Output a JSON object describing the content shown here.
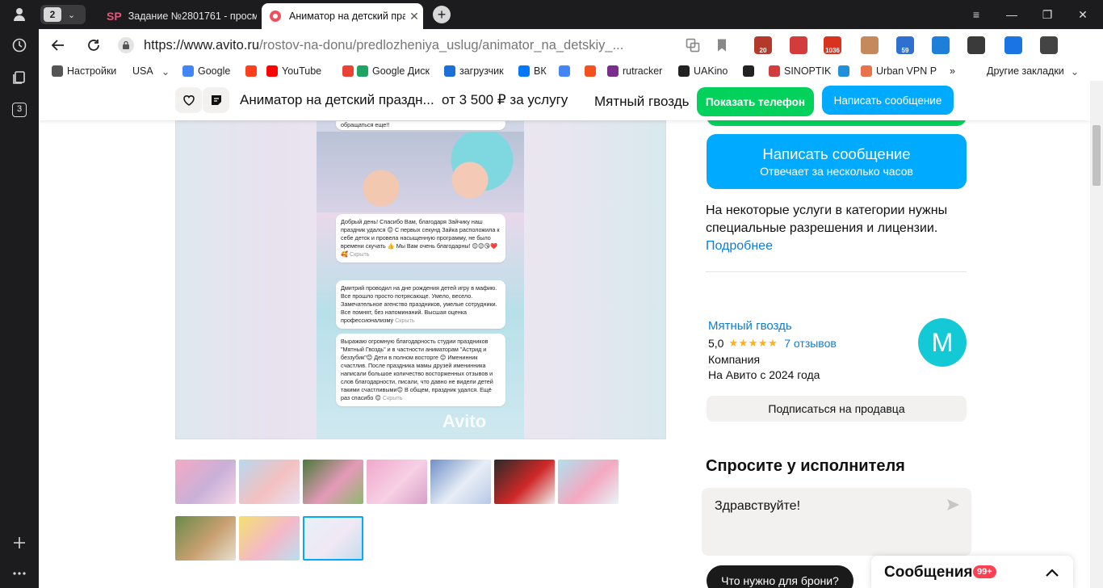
{
  "browser": {
    "tab_group_count": "2",
    "tabs": [
      {
        "favicon": "SP",
        "title": "Задание №2801761 - просм",
        "active": false
      },
      {
        "favicon": "avito-dot",
        "title": "Аниматор на детский празд",
        "active": true
      }
    ],
    "url_host": "https://www.avito.ru",
    "url_path": "/rostov-na-donu/predlozheniya_uslug/animator_na_detskiy_...",
    "rail_badge": "3",
    "extensions": [
      {
        "label": "20",
        "color": "#b33a2b"
      },
      {
        "label": "",
        "color": "#d43c3c"
      },
      {
        "label": "1036",
        "color": "#d9321f"
      },
      {
        "label": "",
        "color": "#c58a5c"
      },
      {
        "label": "59",
        "color": "#2f6fd0"
      },
      {
        "label": "",
        "color": "#1e7fd8"
      },
      {
        "label": "",
        "color": "#3a3a3a"
      },
      {
        "label": "",
        "color": "#1b74e4"
      },
      {
        "label": "",
        "color": "#444444"
      }
    ]
  },
  "bookmarks": [
    {
      "label": "Настройки",
      "icon": "gear-icon",
      "color": "#555555"
    },
    {
      "label": "USA",
      "icon": "",
      "color": ""
    },
    {
      "label": "Google",
      "icon": "google-icon",
      "color": "#4285f4"
    },
    {
      "label": "",
      "icon": "yandex-icon",
      "color": "#fc3f1d"
    },
    {
      "label": "YouTube",
      "icon": "youtube-icon",
      "color": "#ff0000"
    },
    {
      "label": "",
      "icon": "gmail-icon",
      "color": "#ea4335"
    },
    {
      "label": "Google Диск",
      "icon": "drive-icon",
      "color": "#1fa463"
    },
    {
      "label": "загрузчик",
      "icon": "loader-icon",
      "color": "#1b6fd6"
    },
    {
      "label": "ВК",
      "icon": "vk-icon",
      "color": "#0077ff"
    },
    {
      "label": "",
      "icon": "translate-icon",
      "color": "#4285f4"
    },
    {
      "label": "",
      "icon": "f-icon",
      "color": "#f4511e"
    },
    {
      "label": "rutracker",
      "icon": "rutracker-icon",
      "color": "#7b2d8b"
    },
    {
      "label": "UAKino",
      "icon": "uakino-icon",
      "color": "#222222"
    },
    {
      "label": "",
      "icon": "chess-icon",
      "color": "#222222"
    },
    {
      "label": "SINOPTIK",
      "icon": "sinoptik-icon",
      "color": "#d33c3c"
    },
    {
      "label": "",
      "icon": "p-icon",
      "color": "#1e8fd8"
    },
    {
      "label": "Urban VPN P",
      "icon": "urban-icon",
      "color": "#e6734a"
    }
  ],
  "bookmarks_more": "»",
  "bookmarks_other": "Другие закладки",
  "sticky": {
    "title": "Аниматор на детский праздн...",
    "price": "от 3 500 ₽ за услугу",
    "seller": "Мятный гвоздь",
    "phone_button": "Показать телефон",
    "message_button": "Написать сообщение"
  },
  "gallery": {
    "reviews": [
      "Добрый день! Спасибо Вам, благодаря Зайчику наш праздник удался 😊 С первых секунд Зайка расположила к себе деток и провела насыщенную программу, не было времени скучать 👍 Мы Вам очень благодарны! 😊😊😘❤️🥰",
      "Дмитрий проводил на дне рождения детей игру в мафию. Все прошло просто потрясающе. Умело, весело. Замечательное агенство праздников, умелые сотрудники. Все помнят, без напоминаний. Высшая оценка профессионализму",
      "Выражаю огромную благодарность студии праздников \"Мятный Гвоздь\" и в частности аниматорам \"Астрид и беззубик\"😊 Дети в полном восторге 😊 Именинник счастлив. После праздника мамы друзей именинника написали большое количество восторженных отзывов и слов благодарности, писали, что давно не видели детей такими счастливыми😊 В общем, праздник удался. Ещё раз спасибо 😊"
    ],
    "hide_label": "Скрыть",
    "top_fragment": "обращаться еще!!",
    "watermark": "Avito"
  },
  "thumbnails": [
    {
      "colors": [
        "#f4a9c4",
        "#c9b0d8",
        "#f7d6e4"
      ]
    },
    {
      "colors": [
        "#b8d8ee",
        "#f4c0c0",
        "#e8e0f0"
      ]
    },
    {
      "colors": [
        "#4a7a3a",
        "#e49ab8",
        "#8fb870"
      ]
    },
    {
      "colors": [
        "#f0a8cc",
        "#f6d0e4",
        "#d8a0c8"
      ]
    },
    {
      "colors": [
        "#6f90c8",
        "#e8eef6",
        "#b8c8e6"
      ]
    },
    {
      "colors": [
        "#2a2a2a",
        "#d02828",
        "#f0f0f0"
      ]
    },
    {
      "colors": [
        "#b0e0ee",
        "#f4a8c0",
        "#e8f4f8"
      ]
    },
    {
      "colors": [
        "#6a8a4a",
        "#c8a070",
        "#e8e0d0"
      ]
    },
    {
      "colors": [
        "#f4e070",
        "#f4b8c8",
        "#b8e0f0"
      ]
    },
    {
      "colors": [
        "#e8f0f8",
        "#f0e8f4",
        "#c8dcec"
      ],
      "selected": true
    }
  ],
  "right": {
    "message_button_title": "Написать сообщение",
    "message_button_sub": "Отвечает за несколько часов",
    "notice_text": "На некоторые услуги в категории нужны специальные разрешения и лицензии.",
    "notice_link": "Подробнее",
    "seller_name": "Мятный гвоздь",
    "rating_value": "5,0",
    "stars": "★★★★★",
    "reviews_count": "7 отзывов",
    "seller_type": "Компания",
    "on_avito_since": "На Авито с 2024 года",
    "avatar_letter": "М",
    "subscribe_button": "Подписаться на продавца",
    "ask_title": "Спросите у исполнителя",
    "ask_text": "Здравствуйте!",
    "chip_label": "Что нужно для брони?",
    "messages_title": "Сообщения",
    "messages_badge": "99+"
  },
  "colors": {
    "avito_blue": "#00aaff",
    "avito_green": "#02d15c",
    "link_blue": "#0d7dd6",
    "star_yellow": "#ffb021",
    "avatar_teal": "#13c9d6"
  }
}
